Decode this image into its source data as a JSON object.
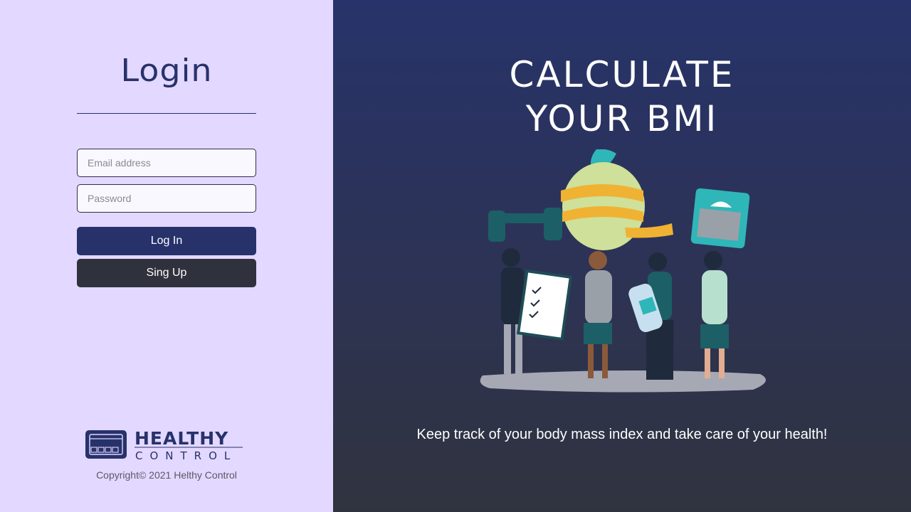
{
  "login": {
    "title": "Login",
    "email_placeholder": "Email address",
    "password_placeholder": "Password",
    "login_label": "Log In",
    "signup_label": "Sing Up"
  },
  "brand": {
    "logo_top": "HEALTHY",
    "logo_bottom": "CONTROL",
    "copyright": "Copyright© 2021 Helthy Control"
  },
  "hero": {
    "headline_line1": "CALCULATE",
    "headline_line2": "YOUR BMI",
    "tagline": "Keep track of your body mass index and take care of your health!",
    "illustration_icon": "fitness-people-illustration"
  },
  "colors": {
    "left_bg": "#e3d8ff",
    "primary": "#27326b",
    "dark": "#2f323d",
    "accent_teal": "#2fb6b8"
  }
}
